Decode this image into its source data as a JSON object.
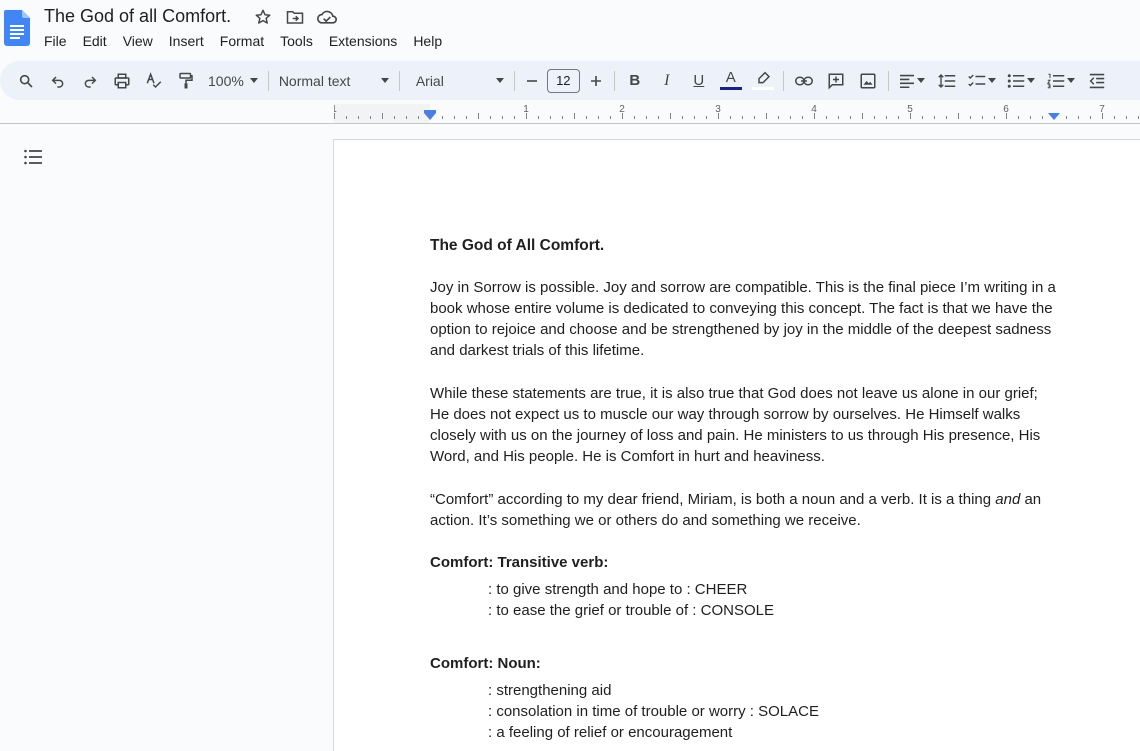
{
  "window": {
    "doc_title": "The God of all Comfort."
  },
  "menu": [
    "File",
    "Edit",
    "View",
    "Insert",
    "Format",
    "Tools",
    "Extensions",
    "Help"
  ],
  "toolbar": {
    "zoom": "100%",
    "style": "Normal text",
    "font": "Arial",
    "font_size": "12",
    "bold": "B",
    "italic": "I",
    "underline": "U",
    "text_color_letter": "A"
  },
  "ruler": {
    "labels": [
      "1",
      "1",
      "2",
      "3",
      "4",
      "5",
      "6",
      "7"
    ]
  },
  "document": {
    "title": "The God of All Comfort.",
    "paragraph1": "Joy in Sorrow is possible. Joy and sorrow are compatible. This is the final piece I’m writing in a book whose entire volume is dedicated to conveying this concept. The fact is that we have the option to rejoice and choose and be strengthened by joy in the middle of the deepest sadness and darkest trials of this lifetime.",
    "paragraph2": "While these statements are true, it is also true that God does not leave us alone in our grief; He does not expect us to muscle our way through sorrow by ourselves. He Himself walks closely with us on the journey of loss and pain. He ministers to us through His presence, His Word, and His people. He is Comfort in hurt and heaviness.",
    "paragraph3_start": "“Comfort” according to my dear friend, Miriam, is both a noun and a verb. It is a thing ",
    "paragraph3_italic": "and",
    "paragraph3_end": " an action. It’s something we or others do and something we receive.",
    "verb_heading": "Comfort: Transitive verb:",
    "verb_defs": [
      ": to give strength and hope to : CHEER",
      ": to ease the grief or trouble of : CONSOLE"
    ],
    "noun_heading": "Comfort: Noun:",
    "noun_defs": [
      ": strengthening aid",
      ": consolation in time of trouble or worry : SOLACE",
      ": a feeling of relief or encouragement"
    ]
  },
  "colors": {
    "doc_icon_blue": "#4285f4",
    "toolbar_bg": "#edf2fa",
    "ruler_marker": "#4a7ee3",
    "text_color_bar": "#1a237e"
  }
}
